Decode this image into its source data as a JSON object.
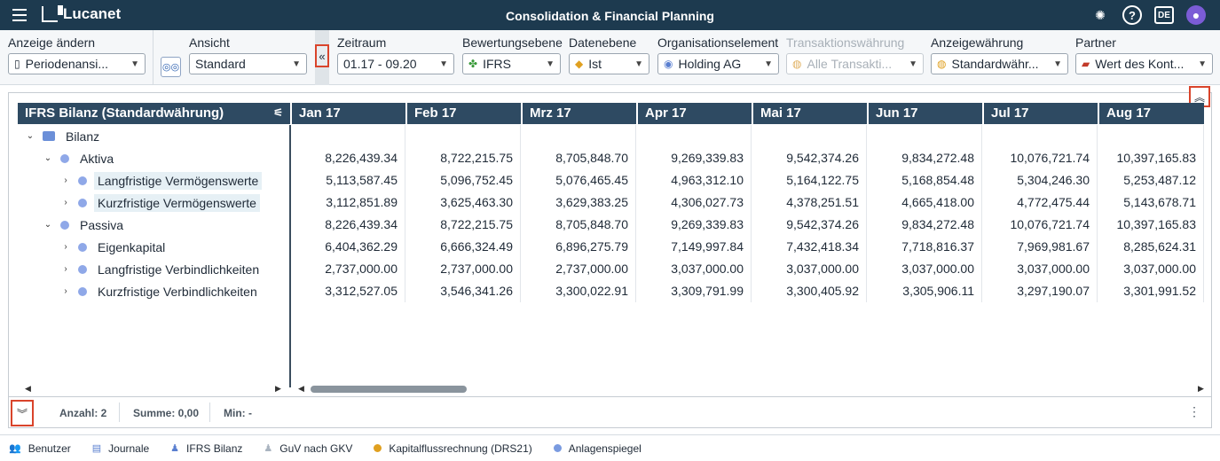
{
  "app": {
    "brand": "Lucanet",
    "title": "Consolidation & Financial Planning",
    "lang": "DE"
  },
  "filters": {
    "anzeige": {
      "label": "Anzeige ändern",
      "value": "Periodenansi..."
    },
    "ansicht": {
      "label": "Ansicht",
      "value": "Standard"
    },
    "zeitraum": {
      "label": "Zeitraum",
      "value": "01.17 - 09.20"
    },
    "bewertung": {
      "label": "Bewertungsebene",
      "value": "IFRS"
    },
    "datenebene": {
      "label": "Datenebene",
      "value": "Ist"
    },
    "orga": {
      "label": "Organisationselement",
      "value": "Holding AG"
    },
    "transaktion": {
      "label": "Transaktionswährung",
      "value": "Alle Transakti..."
    },
    "anzeigewaehrung": {
      "label": "Anzeigewährung",
      "value": "Standardwähr..."
    },
    "partner": {
      "label": "Partner",
      "value": "Wert des Kont..."
    }
  },
  "grid": {
    "title": "IFRS Bilanz (Standardwährung)",
    "columns": [
      "Jan 17",
      "Feb 17",
      "Mrz 17",
      "Apr 17",
      "Mai 17",
      "Jun 17",
      "Jul 17",
      "Aug 17"
    ],
    "rows": [
      {
        "label": "Bilanz",
        "values": [
          "",
          "",
          "",
          "",
          "",
          "",
          "",
          ""
        ]
      },
      {
        "label": "Aktiva",
        "values": [
          "8,226,439.34",
          "8,722,215.75",
          "8,705,848.70",
          "9,269,339.83",
          "9,542,374.26",
          "9,834,272.48",
          "10,076,721.74",
          "10,397,165.83"
        ]
      },
      {
        "label": "Langfristige Vermögenswerte",
        "values": [
          "5,113,587.45",
          "5,096,752.45",
          "5,076,465.45",
          "4,963,312.10",
          "5,164,122.75",
          "5,168,854.48",
          "5,304,246.30",
          "5,253,487.12"
        ]
      },
      {
        "label": "Kurzfristige Vermögenswerte",
        "values": [
          "3,112,851.89",
          "3,625,463.30",
          "3,629,383.25",
          "4,306,027.73",
          "4,378,251.51",
          "4,665,418.00",
          "4,772,475.44",
          "5,143,678.71"
        ]
      },
      {
        "label": "Passiva",
        "values": [
          "8,226,439.34",
          "8,722,215.75",
          "8,705,848.70",
          "9,269,339.83",
          "9,542,374.26",
          "9,834,272.48",
          "10,076,721.74",
          "10,397,165.83"
        ]
      },
      {
        "label": "Eigenkapital",
        "values": [
          "6,404,362.29",
          "6,666,324.49",
          "6,896,275.79",
          "7,149,997.84",
          "7,432,418.34",
          "7,718,816.37",
          "7,969,981.67",
          "8,285,624.31"
        ]
      },
      {
        "label": "Langfristige Verbindlichkeiten",
        "values": [
          "2,737,000.00",
          "2,737,000.00",
          "2,737,000.00",
          "3,037,000.00",
          "3,037,000.00",
          "3,037,000.00",
          "3,037,000.00",
          "3,037,000.00"
        ]
      },
      {
        "label": "Kurzfristige Verbindlichkeiten",
        "values": [
          "3,312,527.05",
          "3,546,341.26",
          "3,300,022.91",
          "3,309,791.99",
          "3,300,405.92",
          "3,305,906.11",
          "3,297,190.07",
          "3,301,991.52"
        ]
      }
    ]
  },
  "status": {
    "anzahl": "Anzahl: 2",
    "summe": "Summe: 0,00",
    "min": "Min: -"
  },
  "tabs": [
    {
      "label": "Benutzer",
      "icon": "users-icon"
    },
    {
      "label": "Journale",
      "icon": "journal-icon"
    },
    {
      "label": "IFRS Bilanz",
      "icon": "person-icon"
    },
    {
      "label": "GuV nach GKV",
      "icon": "person-icon"
    },
    {
      "label": "Kapitalflussrechnung (DRS21)",
      "icon": "dot-icon",
      "color": "#e0a020"
    },
    {
      "label": "Anlagenspiegel",
      "icon": "dot-icon",
      "color": "#7a9be0"
    }
  ],
  "colors": {
    "topbar": "#1d3a4f",
    "header": "#2e4a62",
    "highlight_border": "#d9442b",
    "node_dot": "#8fa8e8"
  }
}
